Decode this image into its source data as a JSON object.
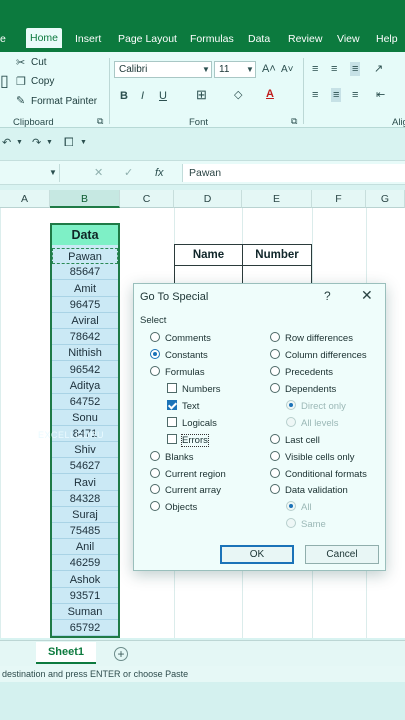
{
  "tabs": [
    "e",
    "Home",
    "Insert",
    "Page Layout",
    "Formulas",
    "Data",
    "Review",
    "View",
    "Help"
  ],
  "clipboard": {
    "cut": "Cut",
    "copy": "Copy",
    "format_painter": "Format Painter",
    "label": "Clipboard"
  },
  "font": {
    "name": "Calibri",
    "size": "11",
    "label": "Font"
  },
  "align_label": "Alig",
  "formula_bar": {
    "fx": "fx",
    "value": "Pawan"
  },
  "columns": [
    "A",
    "B",
    "C",
    "D",
    "E",
    "F",
    "G"
  ],
  "data_column": {
    "header": "Data",
    "values": [
      "Pawan",
      "85647",
      "Amit",
      "96475",
      "Aviral",
      "78642",
      "Nithish",
      "96542",
      "Aditya",
      "64752",
      "Sonu",
      "8471",
      "Shiv",
      "54627",
      "Ravi",
      "84328",
      "Suraj",
      "75485",
      "Anil",
      "46259",
      "Ashok",
      "93571",
      "Suman",
      "65792"
    ]
  },
  "table_headers": {
    "name": "Name",
    "number": "Number"
  },
  "watermark": "EXCELLGURU",
  "sheet": {
    "tab": "Sheet1",
    "add": "+"
  },
  "status_text": "destination and press ENTER or choose Paste",
  "dialog": {
    "title": "Go To Special",
    "help": "?",
    "close": "✕",
    "select_label": "Select",
    "left_options": {
      "comments": "Comments",
      "constants": "Constants",
      "formulas": "Formulas",
      "numbers": "Numbers",
      "text": "Text",
      "logicals": "Logicals",
      "errors": "Errors",
      "blanks": "Blanks",
      "current_region": "Current region",
      "current_array": "Current array",
      "objects": "Objects"
    },
    "right_options": {
      "row_differences": "Row differences",
      "column_differences": "Column differences",
      "precedents": "Precedents",
      "dependents": "Dependents",
      "direct_only": "Direct only",
      "all_levels": "All levels",
      "last_cell": "Last cell",
      "visible_cells_only": "Visible cells only",
      "conditional_formats": "Conditional formats",
      "data_validation": "Data validation",
      "all": "All",
      "same": "Same"
    },
    "ok": "OK",
    "cancel": "Cancel"
  }
}
